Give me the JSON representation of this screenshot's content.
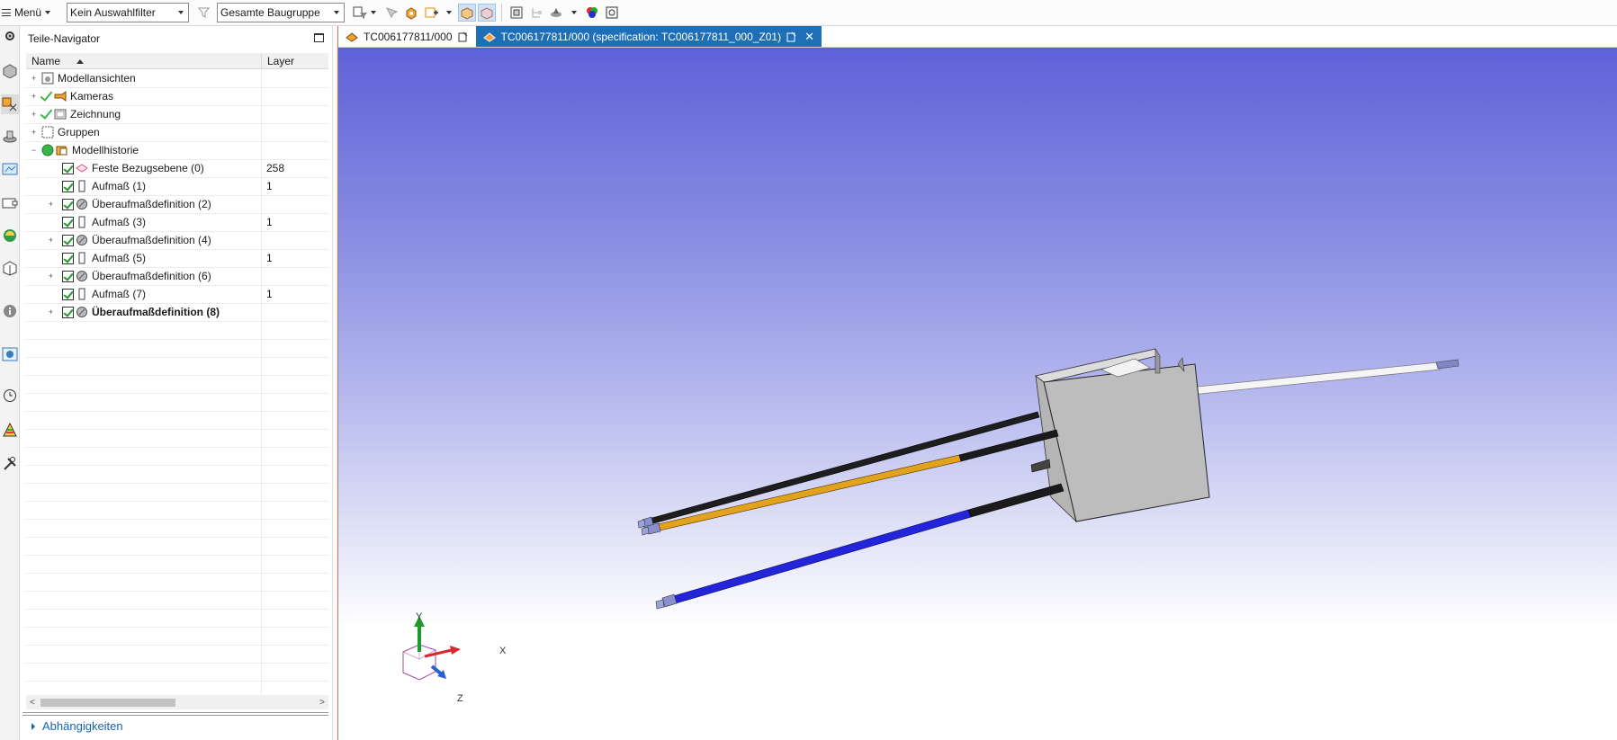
{
  "toolbar": {
    "menu_label": "Menü",
    "selection_filter": "Kein Auswahlfilter",
    "scope_filter": "Gesamte Baugruppe"
  },
  "navigator": {
    "title": "Teile-Navigator",
    "columns": {
      "name": "Name",
      "layer": "Layer"
    },
    "items": [
      {
        "label": "Modellansichten",
        "layer": ""
      },
      {
        "label": "Kameras",
        "layer": ""
      },
      {
        "label": "Zeichnung",
        "layer": ""
      },
      {
        "label": "Gruppen",
        "layer": ""
      },
      {
        "label": "Modellhistorie",
        "layer": ""
      },
      {
        "label": "Feste Bezugsebene (0)",
        "layer": "258"
      },
      {
        "label": "Aufmaß (1)",
        "layer": "1"
      },
      {
        "label": "Überaufmaßdefinition (2)",
        "layer": ""
      },
      {
        "label": "Aufmaß (3)",
        "layer": "1"
      },
      {
        "label": "Überaufmaßdefinition (4)",
        "layer": ""
      },
      {
        "label": "Aufmaß (5)",
        "layer": "1"
      },
      {
        "label": "Überaufmaßdefinition (6)",
        "layer": ""
      },
      {
        "label": "Aufmaß (7)",
        "layer": "1"
      },
      {
        "label": "Überaufmaßdefinition (8)",
        "layer": ""
      }
    ],
    "dependencies_label": "Abhängigkeiten"
  },
  "tabs": [
    {
      "label": "TC006177811/000"
    },
    {
      "label": "TC006177811/000 (specification: TC006177811_000_Z01)"
    }
  ],
  "triad": {
    "x": "X",
    "y": "Y",
    "z": "Z"
  },
  "colors": {
    "accent": "#1e6fb8",
    "viewport_top": "#5e62d8",
    "check": "#1c9b2b"
  }
}
